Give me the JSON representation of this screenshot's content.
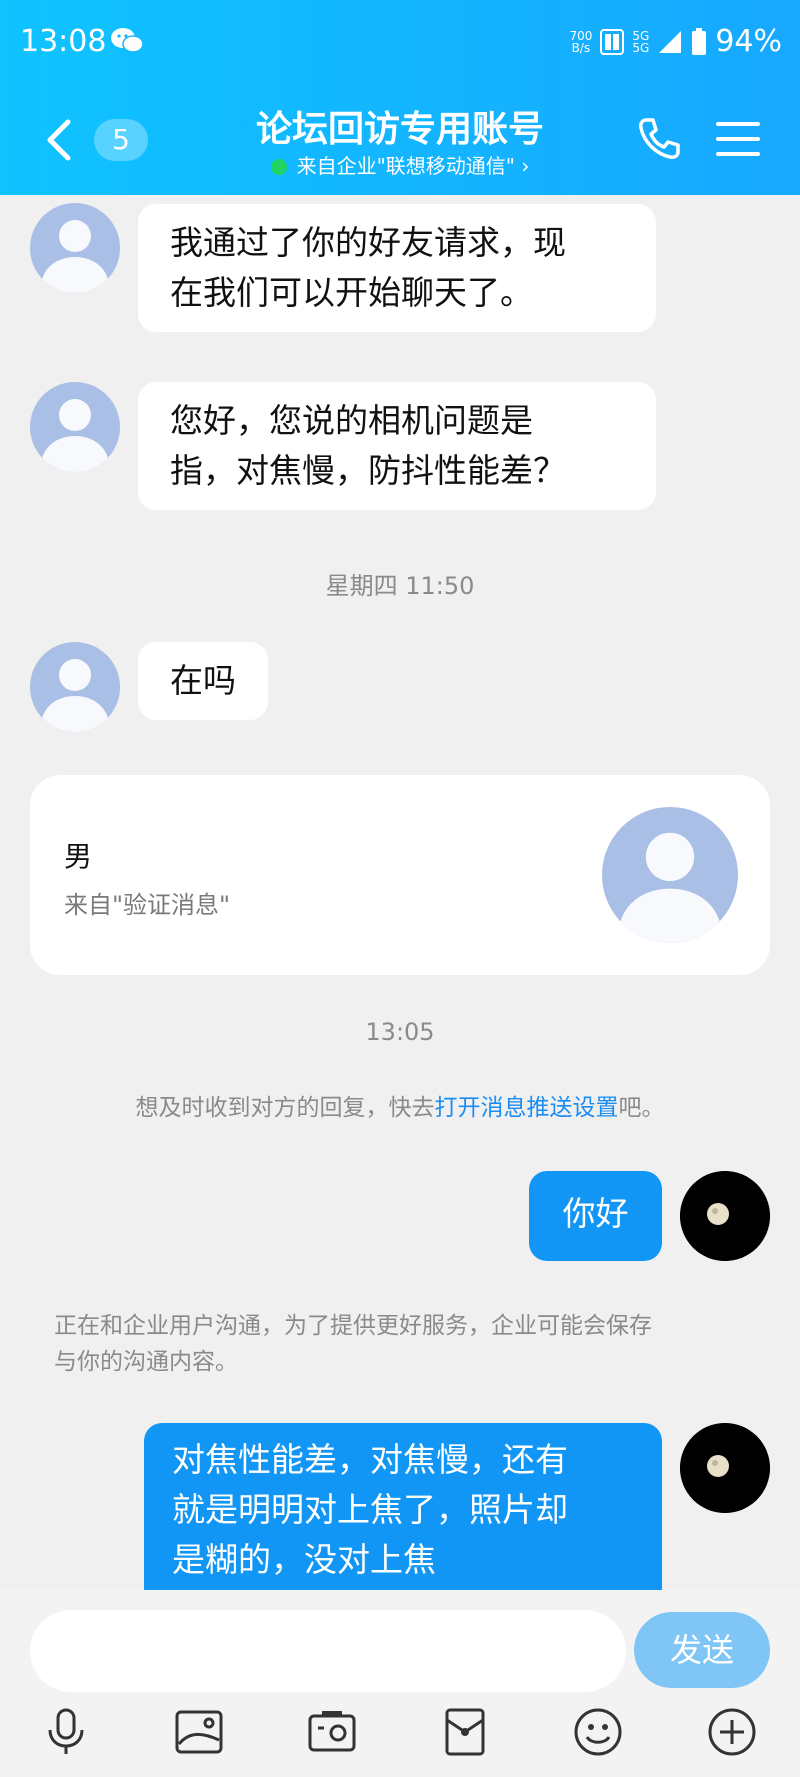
{
  "status_bar": {
    "time": "13:08",
    "net_speed_value": "700",
    "net_speed_unit": "B/s",
    "signal_1": "5G",
    "signal_2": "5G",
    "battery": "94%"
  },
  "header": {
    "back_count": "5",
    "title": "论坛回访专用账号",
    "subtitle": "来自企业\"联想移动通信\" ›"
  },
  "messages": [
    {
      "text_line1": "我通过了你的好友请求，现",
      "text_line2": "在我们可以开始聊天了。"
    },
    {
      "text_line1": "您好，您说的相机问题是",
      "text_line2": "指，对焦慢，防抖性能差？"
    },
    {
      "text": "在吗"
    }
  ],
  "timestamps": {
    "t1": "星期四 11:50",
    "t2": "13:05"
  },
  "card": {
    "name": "男",
    "source": "来自\"验证消息\""
  },
  "notices": {
    "push_prefix": "想及时收到对方的回复，快去",
    "push_link": "打开消息推送设置",
    "push_suffix": "吧。",
    "enterprise_line1": "正在和企业用户沟通，为了提供更好服务，企业可能会保存",
    "enterprise_line2": "与你的沟通内容。"
  },
  "outgoing": [
    {
      "text": "你好"
    },
    {
      "line1": "对焦性能差，对焦慢，还有",
      "line2": "就是明明对上焦了，照片却",
      "line3": "是糊的，没对上焦"
    }
  ],
  "composer": {
    "placeholder": "",
    "send_label": "发送"
  },
  "toolbar_icons": [
    "microphone-icon",
    "image-icon",
    "camera-icon",
    "red-packet-icon",
    "emoji-icon",
    "plus-icon"
  ],
  "colors": {
    "header_start": "#0fc3ff",
    "header_end": "#17a8ff",
    "outgoing_bubble": "#1296f5",
    "send_button": "#7fc6f6",
    "link": "#1a8cf5"
  }
}
